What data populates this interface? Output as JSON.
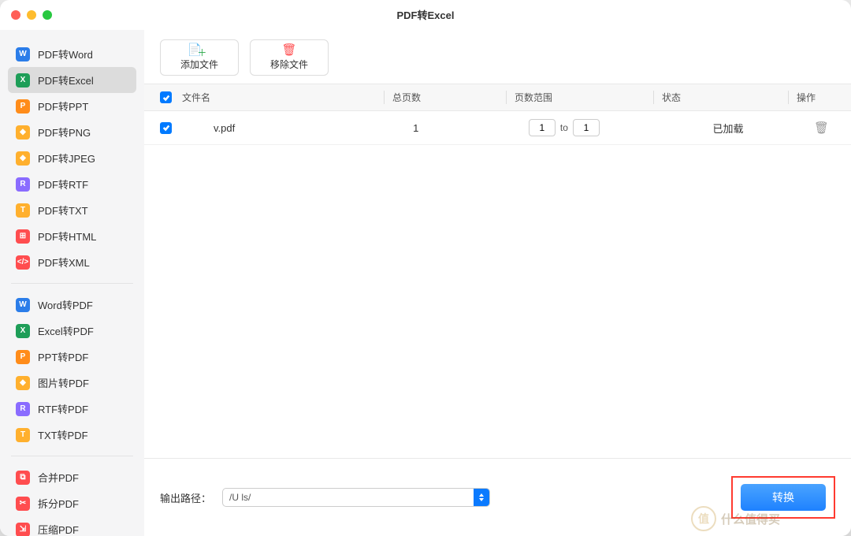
{
  "window": {
    "title": "PDF转Excel"
  },
  "sidebar": {
    "groups": [
      {
        "items": [
          {
            "label": "PDF转Word",
            "icon": "W",
            "color": "#2b7de9"
          },
          {
            "label": "PDF转Excel",
            "icon": "X",
            "color": "#1e9e58",
            "active": true
          },
          {
            "label": "PDF转PPT",
            "icon": "P",
            "color": "#ff8c1a"
          },
          {
            "label": "PDF转PNG",
            "icon": "◆",
            "color": "#ffb02e"
          },
          {
            "label": "PDF转JPEG",
            "icon": "◆",
            "color": "#ffb02e"
          },
          {
            "label": "PDF转RTF",
            "icon": "R",
            "color": "#8a6cff"
          },
          {
            "label": "PDF转TXT",
            "icon": "T",
            "color": "#ffb02e"
          },
          {
            "label": "PDF转HTML",
            "icon": "⊞",
            "color": "#ff4d4f"
          },
          {
            "label": "PDF转XML",
            "icon": "</>",
            "color": "#ff4d4f"
          }
        ]
      },
      {
        "items": [
          {
            "label": "Word转PDF",
            "icon": "W",
            "color": "#2b7de9"
          },
          {
            "label": "Excel转PDF",
            "icon": "X",
            "color": "#1e9e58"
          },
          {
            "label": "PPT转PDF",
            "icon": "P",
            "color": "#ff8c1a"
          },
          {
            "label": "图片转PDF",
            "icon": "◆",
            "color": "#ffb02e"
          },
          {
            "label": "RTF转PDF",
            "icon": "R",
            "color": "#8a6cff"
          },
          {
            "label": "TXT转PDF",
            "icon": "T",
            "color": "#ffb02e"
          }
        ]
      },
      {
        "items": [
          {
            "label": "合并PDF",
            "icon": "⧉",
            "color": "#ff4d4f"
          },
          {
            "label": "拆分PDF",
            "icon": "✂",
            "color": "#ff4d4f"
          },
          {
            "label": "压缩PDF",
            "icon": "⇲",
            "color": "#ff4d4f"
          }
        ]
      }
    ]
  },
  "toolbar": {
    "add": {
      "label": "添加文件",
      "icon_color": "#28a745"
    },
    "remove": {
      "label": "移除文件",
      "icon_color": "#ff4d4f"
    }
  },
  "table": {
    "headers": {
      "filename": "文件名",
      "pages": "总页数",
      "range": "页数范围",
      "status": "状态",
      "action": "操作"
    },
    "range_separator": "to",
    "rows": [
      {
        "checked": true,
        "filename": "v.pdf",
        "total_pages": "1",
        "range_from": "1",
        "range_to": "1",
        "status": "已加载"
      }
    ]
  },
  "footer": {
    "output_label": "输出路径：",
    "output_path_display": "/U                                    ls/",
    "convert_button": "转换"
  },
  "watermark": {
    "badge": "值",
    "text": "什么值得买"
  }
}
